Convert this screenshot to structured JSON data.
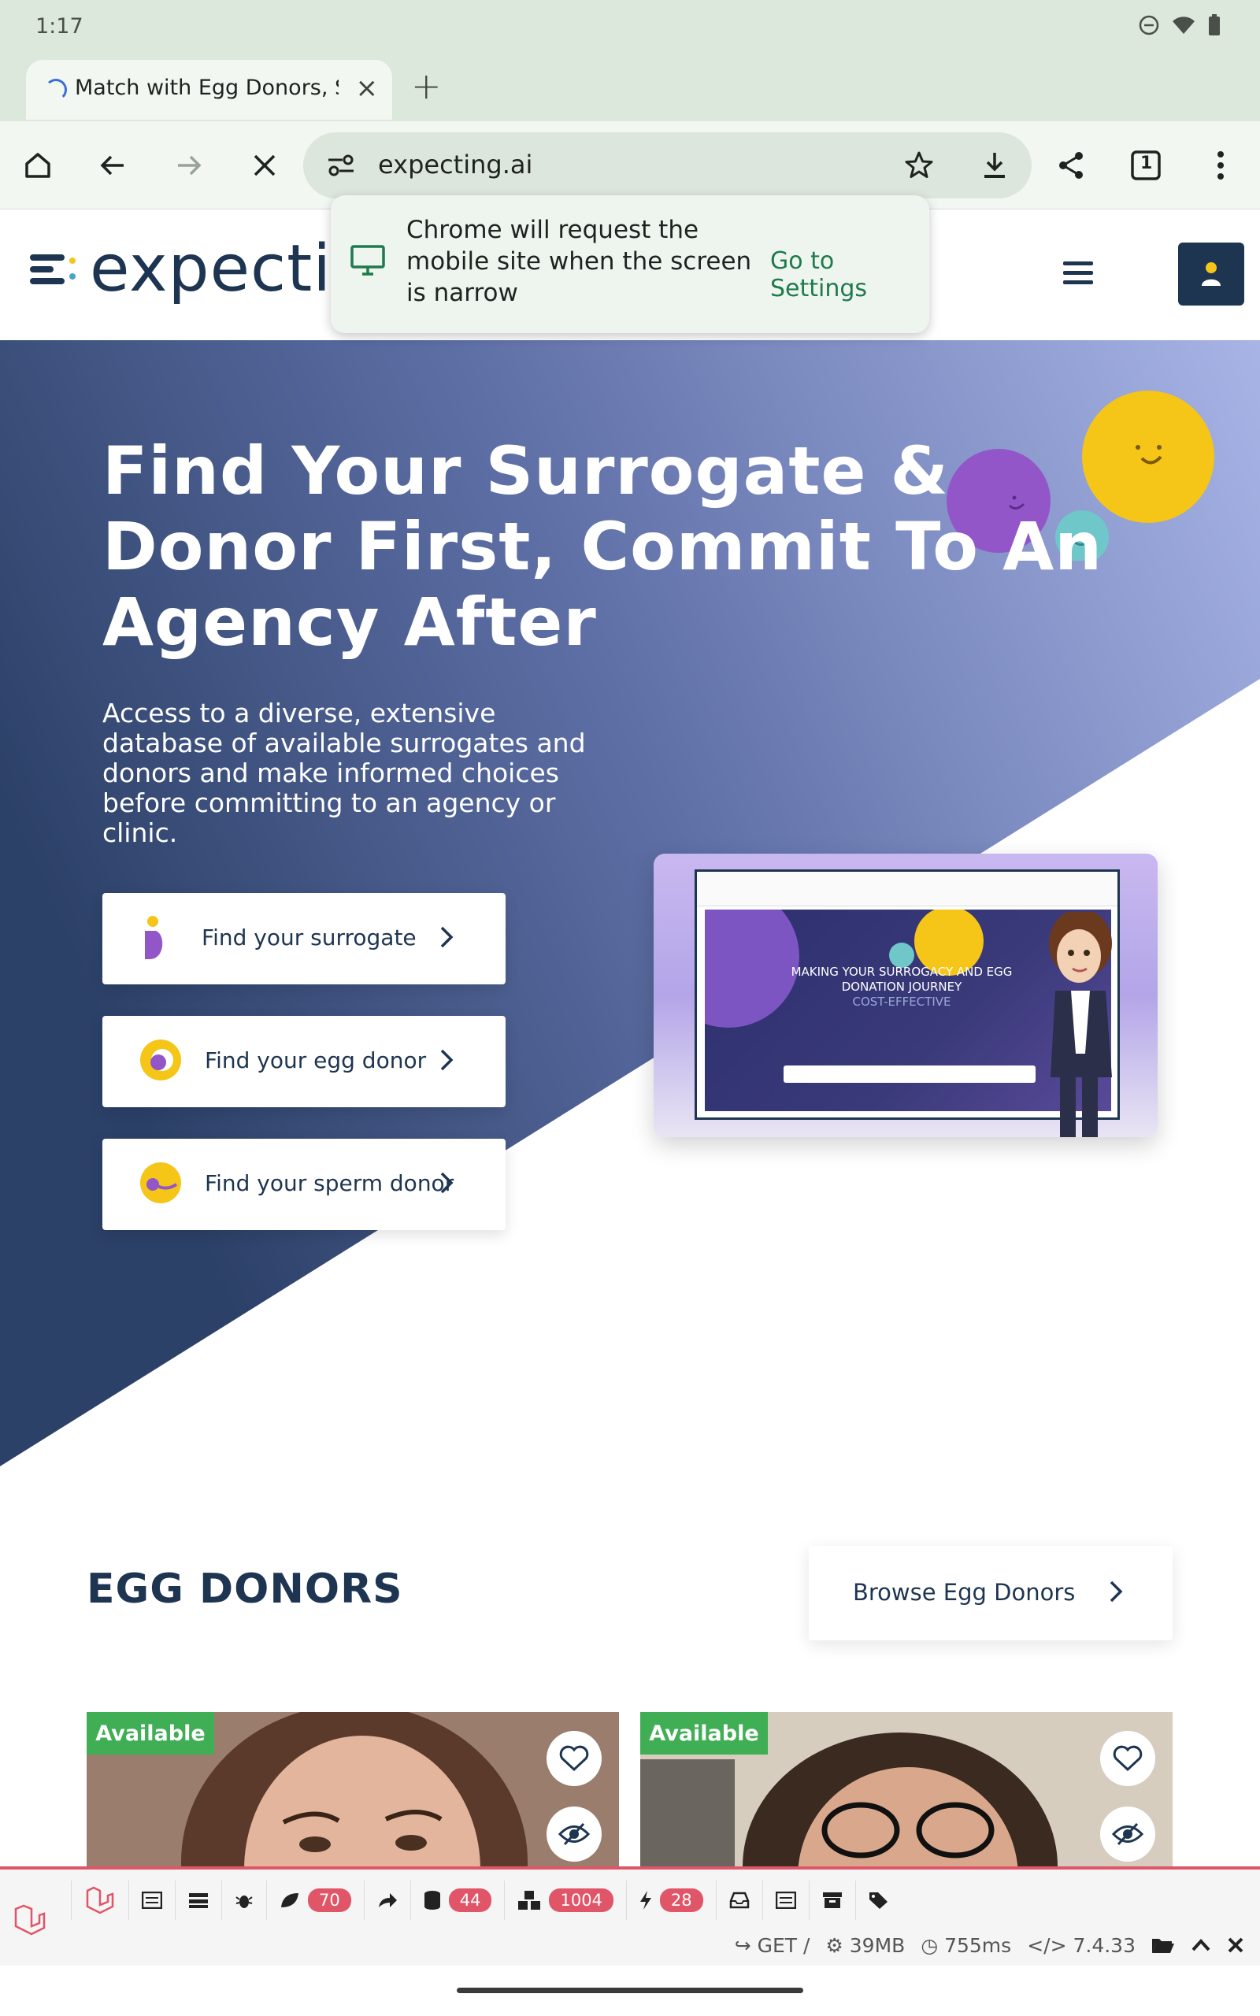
{
  "status_bar": {
    "time": "1:17"
  },
  "browser": {
    "tab_title": "Match with Egg Donors, Su",
    "url": "expecting.ai",
    "tab_count": "1"
  },
  "popup": {
    "message": "Chrome will request the mobile site when the screen is narrow",
    "link": "Go to Settings"
  },
  "site": {
    "logo_text": "expecti"
  },
  "hero": {
    "title": "Find Your Surrogate & Donor First, Commit To An Agency After",
    "subtitle": "Access to a diverse, extensive database of available surrogates and donors and make informed choices before committing to an agency or clinic.",
    "buttons": [
      {
        "label": "Find your surrogate"
      },
      {
        "label": "Find your egg donor"
      },
      {
        "label": "Find your sperm donor"
      }
    ],
    "preview": {
      "line1": "MAKING YOUR SURROGACY AND EGG DONATION JOURNEY",
      "line2": "COST-EFFECTIVE"
    }
  },
  "egg_donors": {
    "title": "EGG DONORS",
    "browse_label": "Browse Egg Donors",
    "cards": [
      {
        "badge": "Available"
      },
      {
        "badge": "Available"
      }
    ]
  },
  "debugbar": {
    "counts": {
      "logs": "70",
      "queries": "44",
      "models": "1004",
      "events": "28"
    },
    "method": "GET /",
    "memory": "39MB",
    "time": "755ms",
    "version": "7.4.33"
  },
  "colors": {
    "brand_navy": "#1e3551",
    "hero_start": "#2c4168",
    "hero_end": "#a8b4e6",
    "available": "#3fae55",
    "debug_accent": "#e05568",
    "chrome_green": "#dce8dc"
  }
}
